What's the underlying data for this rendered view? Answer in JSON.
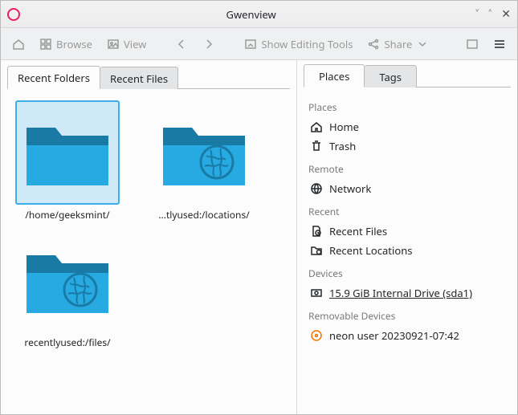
{
  "titlebar": {
    "title": "Gwenview"
  },
  "toolbar": {
    "browse": "Browse",
    "view": "View",
    "editing": "Show Editing Tools",
    "share": "Share"
  },
  "leftTabs": {
    "recentFolders": "Recent Folders",
    "recentFiles": "Recent Files"
  },
  "rightTabs": {
    "places": "Places",
    "tags": "Tags"
  },
  "folders": [
    {
      "label": "/home/geeksmint/",
      "globe": false,
      "selected": true
    },
    {
      "label": "...tlyused:/locations/",
      "globe": true,
      "selected": false
    },
    {
      "label": "recentlyused:/files/",
      "globe": true,
      "selected": false
    }
  ],
  "sidebar": {
    "sections": {
      "places": {
        "title": "Places",
        "items": [
          "Home",
          "Trash"
        ]
      },
      "remote": {
        "title": "Remote",
        "items": [
          "Network"
        ]
      },
      "recent": {
        "title": "Recent",
        "items": [
          "Recent Files",
          "Recent Locations"
        ]
      },
      "devices": {
        "title": "Devices",
        "items": [
          "15.9 GiB Internal Drive (sda1)"
        ]
      },
      "removable": {
        "title": "Removable Devices",
        "items": [
          "neon user 20230921-07:42"
        ]
      }
    }
  }
}
